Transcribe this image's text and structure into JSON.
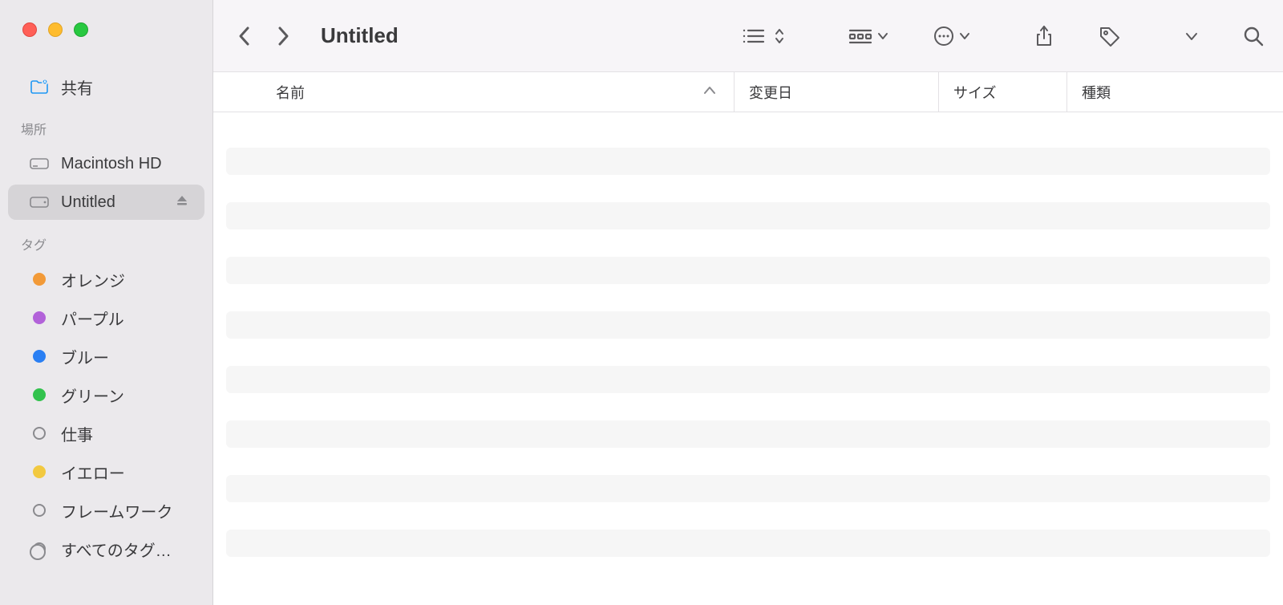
{
  "window": {
    "title": "Untitled"
  },
  "sidebar": {
    "shared": {
      "label": "共有"
    },
    "locations": {
      "header": "場所",
      "items": [
        {
          "label": "Macintosh HD"
        },
        {
          "label": "Untitled"
        }
      ]
    },
    "tags": {
      "header": "タグ",
      "items": [
        {
          "label": "オレンジ",
          "color": "#f29a38"
        },
        {
          "label": "パープル",
          "color": "#b262d9"
        },
        {
          "label": "ブルー",
          "color": "#2a7ff3"
        },
        {
          "label": "グリーン",
          "color": "#32c24d"
        },
        {
          "label": "仕事",
          "color": "empty"
        },
        {
          "label": "イエロー",
          "color": "#f2c940"
        },
        {
          "label": "フレームワーク",
          "color": "empty"
        },
        {
          "label": "すべてのタグ…",
          "color": "multi"
        }
      ]
    }
  },
  "columns": {
    "name": "名前",
    "date": "変更日",
    "size": "サイズ",
    "kind": "種類"
  }
}
